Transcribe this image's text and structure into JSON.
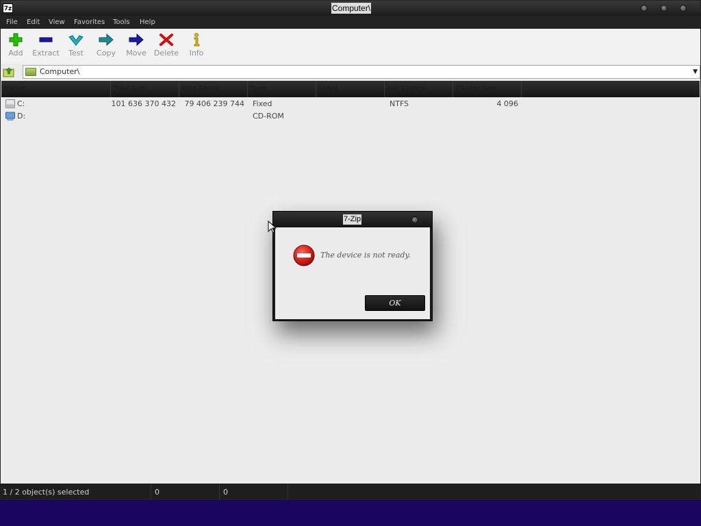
{
  "window": {
    "title": "Computer\\",
    "app_icon_label": "7z"
  },
  "menu": {
    "items": [
      "File",
      "Edit",
      "View",
      "Favorites",
      "Tools",
      "Help"
    ]
  },
  "toolbar": {
    "add_label": "Add",
    "extract_label": "Extract",
    "test_label": "Test",
    "copy_label": "Copy",
    "move_label": "Move",
    "delete_label": "Delete",
    "info_label": "Info"
  },
  "address": {
    "path": "Computer\\"
  },
  "file_list": {
    "headers": [
      "Name",
      "Total Size",
      "Free Space",
      "Type",
      "Label",
      "File System",
      "Cluster Size"
    ],
    "rows": [
      {
        "name": "C:",
        "total_size": "101 636 370 432",
        "free_space": "79 406 239 744",
        "type": "Fixed",
        "label": "",
        "file_system": "NTFS",
        "cluster_size": "4 096",
        "icon": "hard-drive-icon"
      },
      {
        "name": "D:",
        "total_size": "",
        "free_space": "",
        "type": "CD-ROM",
        "label": "",
        "file_system": "",
        "cluster_size": "",
        "icon": "cd-drive-icon"
      }
    ]
  },
  "status": {
    "selection": "1 / 2 object(s) selected",
    "size": "0",
    "packed": "0"
  },
  "dialog": {
    "title": "7-Zip",
    "message": "The device is not ready.",
    "ok_label": "OK",
    "icon": "error-icon"
  },
  "colors": {
    "title_bar": "#1c1c1c",
    "desktop": "#1a0660",
    "error_red": "#d0201a",
    "add_green": "#22c000",
    "extract_blue": "#1a1aa0",
    "test_cyan": "#20b0c0",
    "copy_teal": "#208890",
    "delete_red": "#d01010",
    "info_yellow": "#e0c000"
  }
}
